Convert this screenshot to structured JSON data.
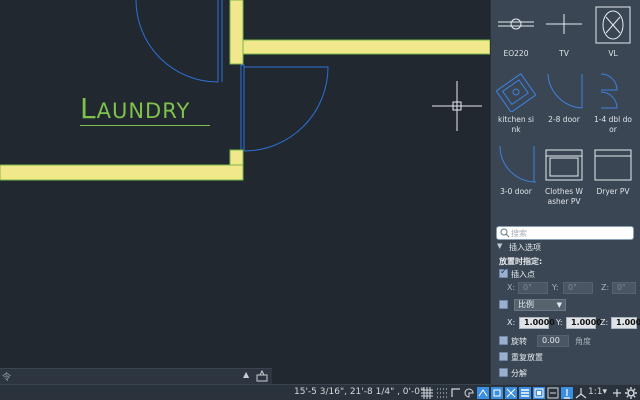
{
  "drawing": {
    "room_label_initial": "L",
    "room_label_rest": "AUNDRY"
  },
  "command_line": {
    "prompt": "令",
    "caret": "▲"
  },
  "status_bar": {
    "coords": "15'-5 3/16\", 21'-8 1/4\" , 0'-0\"",
    "scale": "1:1▾"
  },
  "palette": {
    "tiles": [
      {
        "label": "EO220",
        "icon": "eo220-symbol-icon"
      },
      {
        "label": "TV",
        "icon": "tv-symbol-icon"
      },
      {
        "label": "VL",
        "icon": "vl-symbol-icon"
      },
      {
        "label": "kitchen si nk",
        "icon": "kitchen-sink-icon"
      },
      {
        "label": "2-8 door",
        "icon": "door-2-8-icon"
      },
      {
        "label": "1-4 dbl do or",
        "icon": "door-1-4-dbl-icon"
      },
      {
        "label": "3-0 door",
        "icon": "door-3-0-icon"
      },
      {
        "label": "Clothes W asher PV",
        "icon": "washer-icon"
      },
      {
        "label": "Dryer PV",
        "icon": "dryer-icon"
      }
    ],
    "search": {
      "placeholder": "搜索"
    },
    "insert_options": {
      "title": "插入选项",
      "place_when": "放置时指定:",
      "insert_point_label": "插入点",
      "x_label": "X:",
      "y_label": "Y:",
      "z_label": "Z:",
      "x_value": "0\"",
      "y_value": "0\"",
      "z_value": "0\"",
      "scale_dropdown": "比例",
      "sx_value": "1.0000",
      "sy_value": "1.0000",
      "sz_value": "1.000",
      "rotate_label": "旋转",
      "rotate_value": "0.00",
      "angle_label": "角度",
      "repeat_label": "重复放置",
      "explode_label": "分解"
    }
  },
  "colors": {
    "canvas_bg": "#212830",
    "wall_fill": "#f1e88b",
    "wall_edge": "#77b84a",
    "door_blue": "#2f6fd6",
    "label_green": "#7fc24b",
    "palette_bg": "#3b4654"
  }
}
